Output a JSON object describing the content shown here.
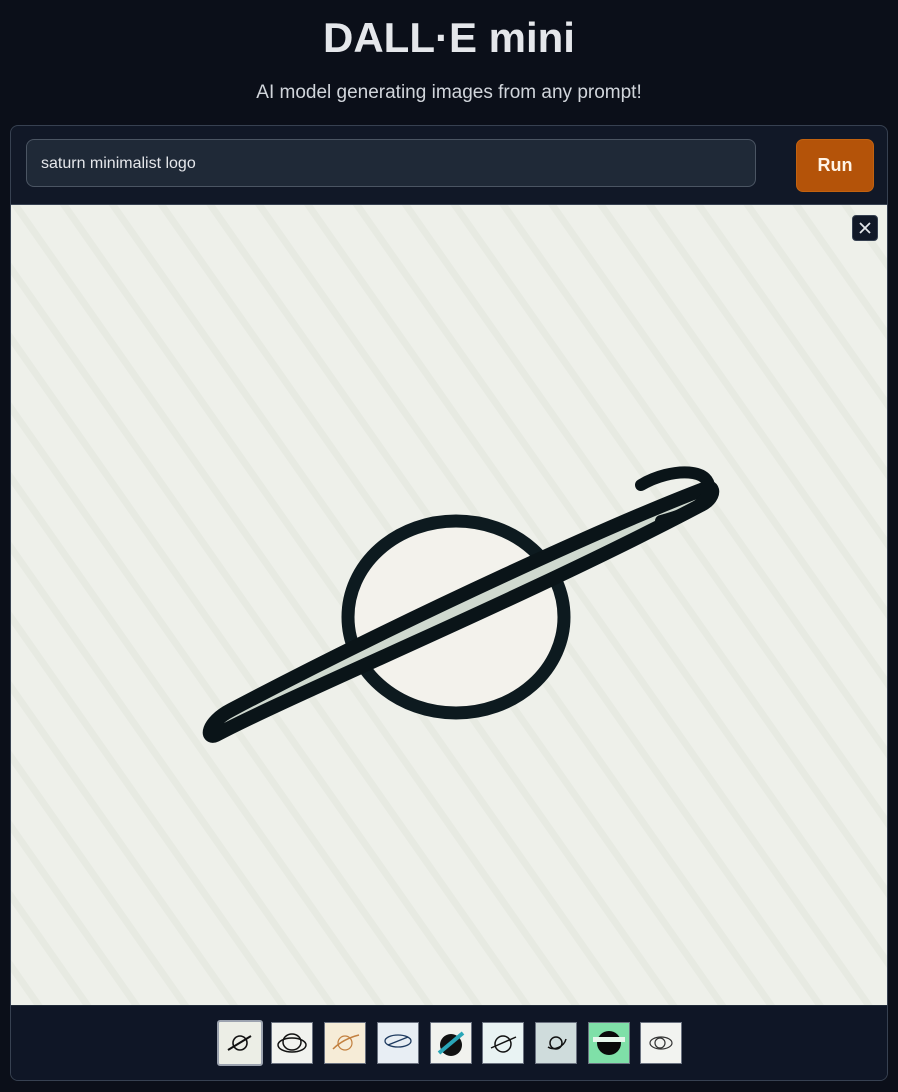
{
  "app": {
    "title": "DALL·E mini",
    "subtitle": "AI model generating images from any prompt!"
  },
  "prompt": {
    "value": "saturn minimalist logo"
  },
  "run_button": {
    "label": "Run"
  },
  "viewer": {
    "image_icon": "saturn-image",
    "close_icon": "close-icon"
  },
  "thumbnails": [
    {
      "icon": "thumbnail-1",
      "selected": true
    },
    {
      "icon": "thumbnail-2",
      "selected": false
    },
    {
      "icon": "thumbnail-3",
      "selected": false
    },
    {
      "icon": "thumbnail-4",
      "selected": false
    },
    {
      "icon": "thumbnail-5",
      "selected": false
    },
    {
      "icon": "thumbnail-6",
      "selected": false
    },
    {
      "icon": "thumbnail-7",
      "selected": false
    },
    {
      "icon": "thumbnail-8",
      "selected": false
    },
    {
      "icon": "thumbnail-9",
      "selected": false
    }
  ],
  "colors": {
    "background": "#0b0f19",
    "panel": "#111827",
    "run_button": "#b45309",
    "image_bg": "#eef0ea"
  }
}
